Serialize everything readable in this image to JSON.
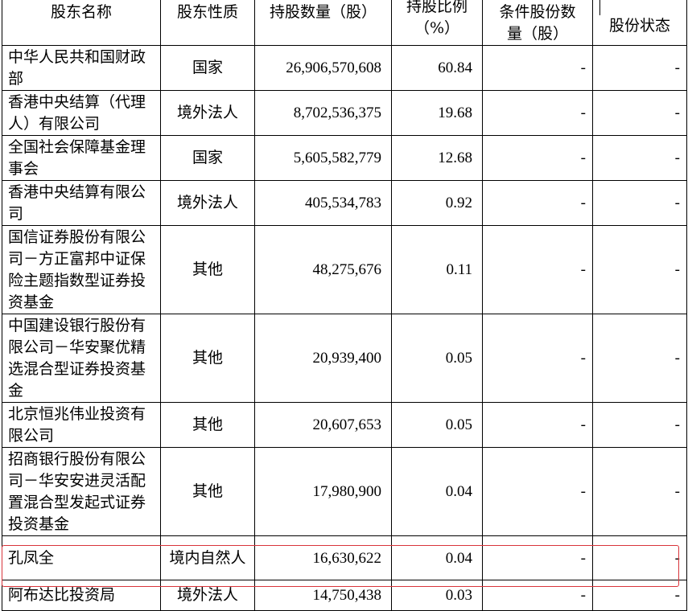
{
  "table": {
    "headers": {
      "name": "股东名称",
      "type": "股东性质",
      "shares": "持股数量（股）",
      "ratio_line1": "持股比例",
      "ratio_line2": "（%）",
      "cond_line1": "条件股份数",
      "cond_line2": "量（股）",
      "status": "股份状态"
    },
    "rows": [
      {
        "name": "中华人民共和国财政部",
        "type": "国家",
        "shares": "26,906,570,608",
        "ratio": "60.84",
        "cond": "-",
        "status": "-"
      },
      {
        "name": "香港中央结算（代理人）有限公司",
        "type": "境外法人",
        "shares": "8,702,536,375",
        "ratio": "19.68",
        "cond": "-",
        "status": "-"
      },
      {
        "name": "全国社会保障基金理事会",
        "type": "国家",
        "shares": "5,605,582,779",
        "ratio": "12.68",
        "cond": "-",
        "status": "-"
      },
      {
        "name": "香港中央结算有限公司",
        "type": "境外法人",
        "shares": "405,534,783",
        "ratio": "0.92",
        "cond": "-",
        "status": "-"
      },
      {
        "name": "国信证券股份有限公司－方正富邦中证保险主题指数型证券投资基金",
        "type": "其他",
        "shares": "48,275,676",
        "ratio": "0.11",
        "cond": "-",
        "status": "-"
      },
      {
        "name": "中国建设银行股份有限公司－华安聚优精选混合型证券投资基金",
        "type": "其他",
        "shares": "20,939,400",
        "ratio": "0.05",
        "cond": "-",
        "status": "-"
      },
      {
        "name": "北京恒兆伟业投资有限公司",
        "type": "其他",
        "shares": "20,607,653",
        "ratio": "0.05",
        "cond": "-",
        "status": "-"
      },
      {
        "name": "招商银行股份有限公司－华安安进灵活配置混合型发起式证券投资基金",
        "type": "其他",
        "shares": "17,980,900",
        "ratio": "0.04",
        "cond": "-",
        "status": "-"
      },
      {
        "name": "孔凤全",
        "type": "境内自然人",
        "shares": "16,630,622",
        "ratio": "0.04",
        "cond": "-",
        "status": "-"
      },
      {
        "name": "阿布达比投资局",
        "type": "境外法人",
        "shares": "14,750,438",
        "ratio": "0.03",
        "cond": "-",
        "status": "-"
      }
    ]
  }
}
